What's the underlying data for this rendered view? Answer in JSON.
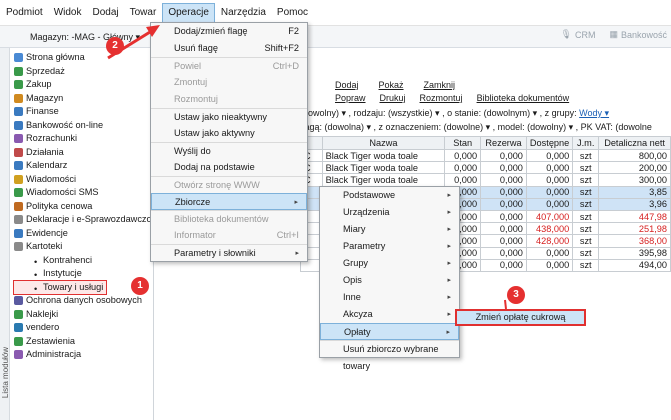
{
  "menubar": [
    "Podmiot",
    "Widok",
    "Dodaj",
    "Towar",
    "Operacje",
    "Narzędzia",
    "Pomoc"
  ],
  "toolbar": {
    "magazyn": "Magazyn: -MAG - Główny ▾",
    "crm": "CRM",
    "bank": "Bankowość"
  },
  "sidebar": {
    "strip": "Lista modułów",
    "items": [
      {
        "label": "Strona główna"
      },
      {
        "label": "Sprzedaż"
      },
      {
        "label": "Zakup"
      },
      {
        "label": "Magazyn"
      },
      {
        "label": "Finanse"
      },
      {
        "label": "Bankowość on-line"
      },
      {
        "label": "Rozrachunki"
      },
      {
        "label": "Działania"
      },
      {
        "label": "Kalendarz"
      },
      {
        "label": "Wiadomości"
      },
      {
        "label": "Wiadomości SMS"
      },
      {
        "label": "Polityka cenowa"
      },
      {
        "label": "Deklaracje i e-Sprawozdawczo"
      },
      {
        "label": "Ewidencje"
      },
      {
        "label": "Kartoteki"
      },
      {
        "label": "Kontrahenci"
      },
      {
        "label": "Instytucje"
      },
      {
        "label": "Towary i usługi"
      },
      {
        "label": "Ochrona danych osobowych"
      },
      {
        "label": "Naklejki"
      },
      {
        "label": "vendero"
      },
      {
        "label": "Zestawienia"
      },
      {
        "label": "Administracja"
      }
    ]
  },
  "links": {
    "row1": [
      "Dodaj",
      "Pokaż",
      "Zamknij"
    ],
    "row2": [
      "Popraw",
      "Drukuj",
      "Rozmontuj",
      "Biblioteka dokumentów"
    ]
  },
  "filters": {
    "line1": "(dowolny) ▾ , rodzaju:  (wszystkie) ▾ , o stanie:  (dowolnym) ▾ , z grupy:",
    "group": "Wody ▾",
    "line2": "flagą: (dowolna) ▾ , z oznaczeniem:  (dowolne) ▾ , model:  (dowolny) ▾ , PK VAT:  (dowolne"
  },
  "table": {
    "headers": [
      "",
      "Nazwa",
      "Stan",
      "Rezerwa",
      "Dostępne",
      "J.m.",
      "Detaliczna nett"
    ],
    "rows": [
      {
        "code": "C",
        "name": "Black Tiger woda toale",
        "stan": "0,000",
        "rez": "0,000",
        "dost": "0,000",
        "jm": "szt",
        "det": "800,00",
        "hl": false,
        "red": false
      },
      {
        "code": "C",
        "name": "Black Tiger woda toale",
        "stan": "0,000",
        "rez": "0,000",
        "dost": "0,000",
        "jm": "szt",
        "det": "200,00",
        "hl": false,
        "red": false
      },
      {
        "code": "C",
        "name": "Black Tiger woda toale",
        "stan": "0,000",
        "rez": "0,000",
        "dost": "0,000",
        "jm": "szt",
        "det": "300,00",
        "hl": false,
        "red": false
      },
      {
        "code": "",
        "name": "",
        "stan": "0,000",
        "rez": "0,000",
        "dost": "0,000",
        "jm": "szt",
        "det": "3,85",
        "hl": true,
        "red": false
      },
      {
        "code": "",
        "name": "",
        "stan": "0,000",
        "rez": "0,000",
        "dost": "0,000",
        "jm": "szt",
        "det": "3,96",
        "hl": true,
        "red": false
      },
      {
        "code": "",
        "name": "",
        "stan": "0,000",
        "rez": "0,000",
        "dost": "407,000",
        "jm": "szt",
        "det": "447,98",
        "hl": false,
        "red": true
      },
      {
        "code": "",
        "name": "",
        "stan": "0,000",
        "rez": "0,000",
        "dost": "438,000",
        "jm": "szt",
        "det": "251,98",
        "hl": false,
        "red": true
      },
      {
        "code": "",
        "name": "",
        "stan": "0,000",
        "rez": "0,000",
        "dost": "428,000",
        "jm": "szt",
        "det": "368,00",
        "hl": false,
        "red": true
      },
      {
        "code": "",
        "name": "WOFORE",
        "stan": "0,000",
        "rez": "0,000",
        "dost": "0,000",
        "jm": "szt",
        "det": "395,98",
        "hl": false,
        "red": false
      },
      {
        "code": "",
        "name": "WOPINKL",
        "stan": "0,000",
        "rez": "0,000",
        "dost": "0,000",
        "jm": "szt",
        "det": "494,00",
        "hl": false,
        "red": false
      }
    ]
  },
  "menu1": [
    {
      "label": "Dodaj/zmień flagę",
      "key": "F2",
      "dis": false,
      "sep": false
    },
    {
      "label": "Usuń flagę",
      "key": "Shift+F2",
      "dis": false,
      "sep": false
    },
    {
      "label": "Powiel",
      "key": "Ctrl+D",
      "dis": true,
      "sep": true
    },
    {
      "label": "Zmontuj",
      "key": "",
      "dis": true,
      "sep": false
    },
    {
      "label": "Rozmontuj",
      "key": "",
      "dis": true,
      "sep": false
    },
    {
      "label": "Ustaw jako nieaktywny",
      "key": "",
      "dis": false,
      "sep": true
    },
    {
      "label": "Ustaw jako aktywny",
      "key": "",
      "dis": false,
      "sep": false
    },
    {
      "label": "Wyślij do",
      "key": "",
      "dis": false,
      "sep": true
    },
    {
      "label": "Dodaj na podstawie",
      "key": "",
      "dis": false,
      "sep": false
    },
    {
      "label": "Otwórz stronę WWW",
      "key": "",
      "dis": true,
      "sep": true
    },
    {
      "label": "Zbiorcze",
      "key": "▸",
      "dis": false,
      "sep": true,
      "act": true
    },
    {
      "label": "Biblioteka dokumentów",
      "key": "",
      "dis": true,
      "sep": true
    },
    {
      "label": "Informator",
      "key": "Ctrl+I",
      "dis": true,
      "sep": false
    },
    {
      "label": "Parametry i słowniki",
      "key": "▸",
      "dis": false,
      "sep": true
    }
  ],
  "menu2": [
    {
      "label": "Podstawowe"
    },
    {
      "label": "Urządzenia"
    },
    {
      "label": "Miary"
    },
    {
      "label": "Parametry"
    },
    {
      "label": "Grupy"
    },
    {
      "label": "Opis"
    },
    {
      "label": "Inne"
    },
    {
      "label": "Akcyza"
    },
    {
      "label": "Opłaty",
      "act": true
    },
    {
      "label": "Usuń zbiorczo wybrane towary",
      "sep": true
    }
  ],
  "final": "Zmień opłatę cukrową",
  "badges": [
    "1",
    "2",
    "3"
  ]
}
